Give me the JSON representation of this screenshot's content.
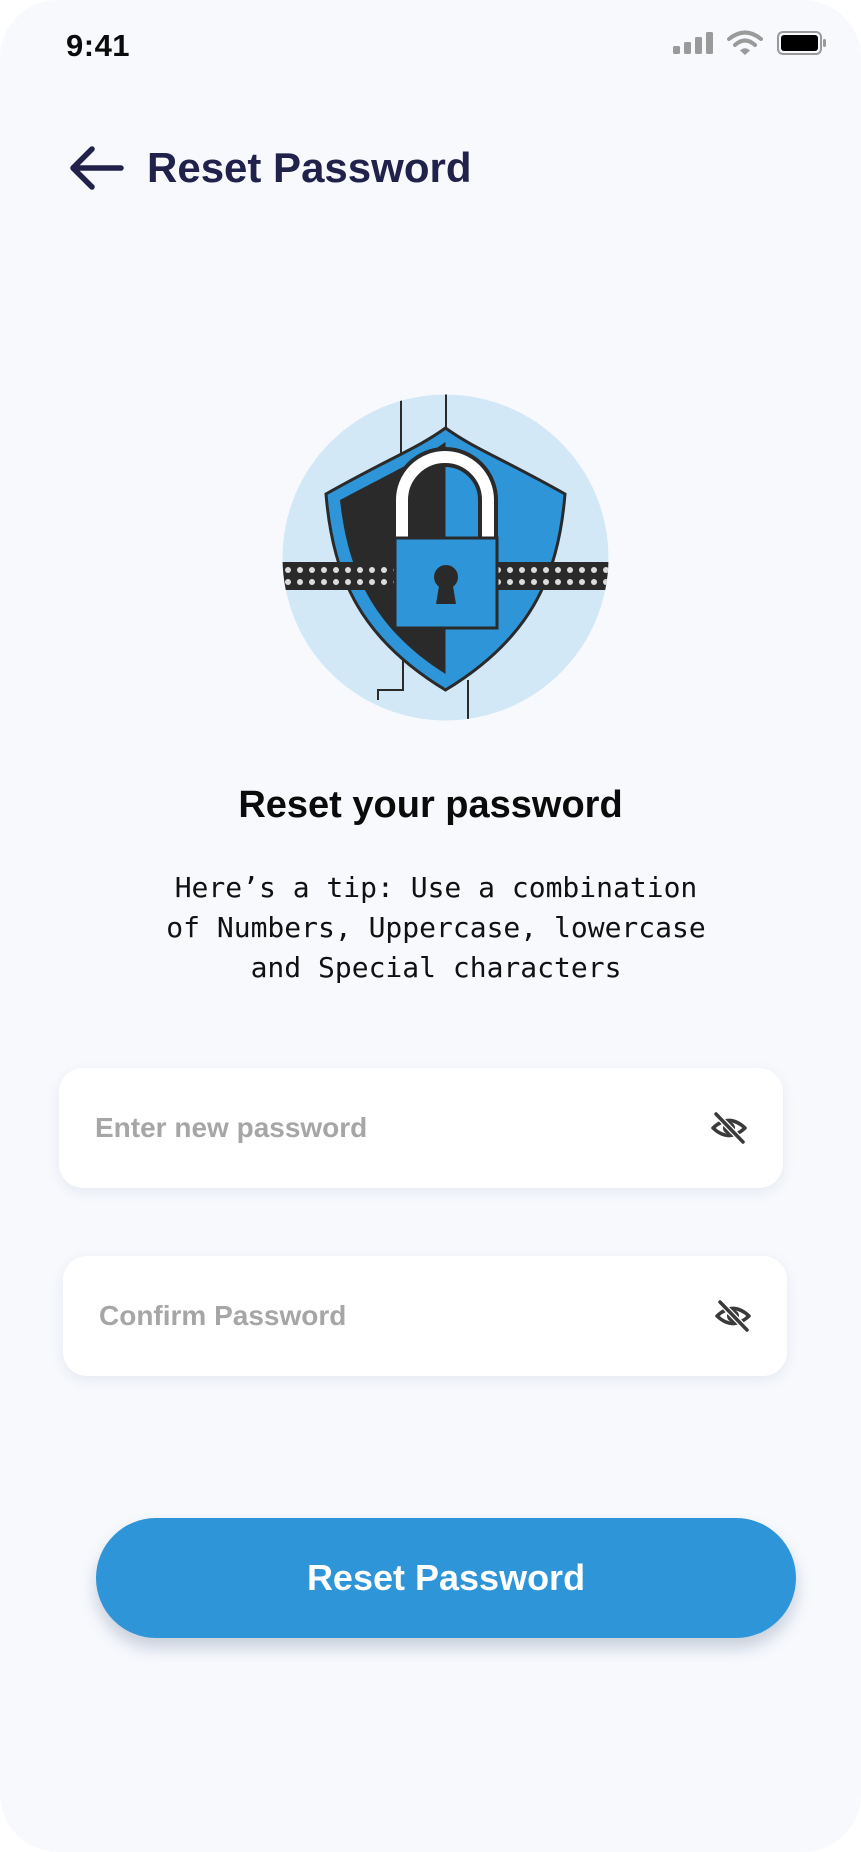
{
  "status_bar": {
    "time": "9:41"
  },
  "header": {
    "title": "Reset Password"
  },
  "content": {
    "heading": "Reset your password",
    "tip": "Here’s a tip: Use a combination of Numbers, Uppercase, lowercase and Special characters"
  },
  "form": {
    "new_password": {
      "placeholder": "Enter new password",
      "value": ""
    },
    "confirm_password": {
      "placeholder": "Confirm Password",
      "value": ""
    },
    "submit_label": "Reset Password"
  },
  "icons": {
    "back": "arrow-left-icon",
    "visibility": "eye-slash-icon",
    "illustration": "shield-lock-illustration"
  },
  "colors": {
    "primary": "#2e96d8",
    "title": "#20224b",
    "background": "#f7f9fd",
    "illustration_bg": "#d3e8f6"
  }
}
